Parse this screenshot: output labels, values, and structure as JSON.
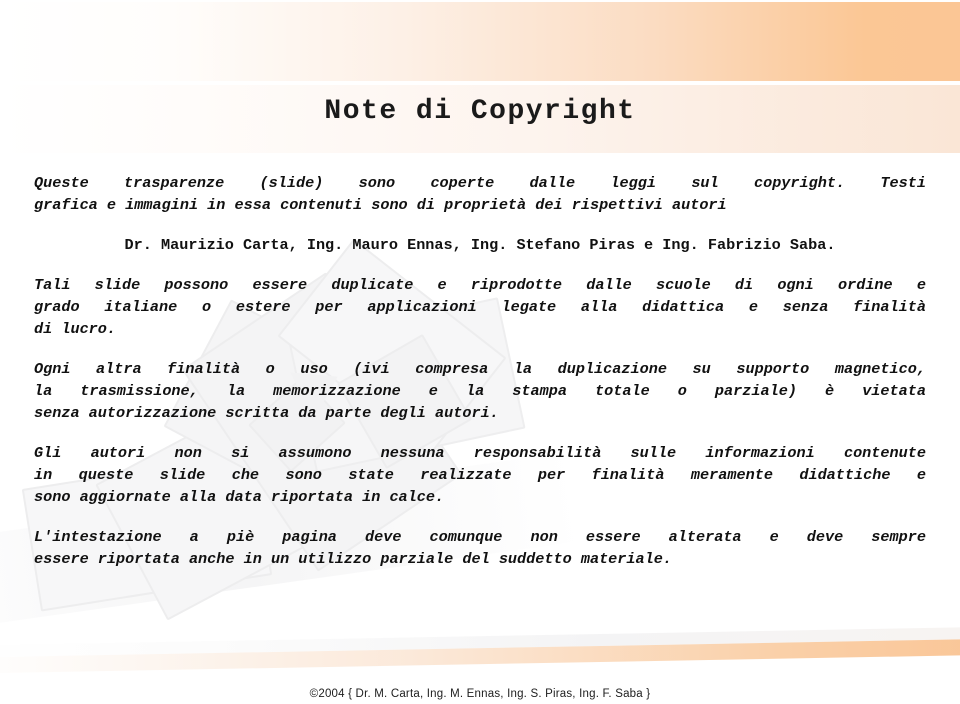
{
  "slide": {
    "title": "Note di Copyright",
    "accent_color": "#fbc695",
    "band_light_color": "#fae6d6",
    "text_color": "#111111"
  },
  "paragraphs": [
    {
      "id": "copyright-notice",
      "style": "bold-italic",
      "lines": [
        "Queste trasparenze (slide) sono coperte dalle leggi sul copyright. Testi",
        "grafica e immagini in essa contenuti sono di proprietà dei rispettivi autori"
      ]
    },
    {
      "id": "authors",
      "style": "bold",
      "lines": [
        "Dr. Maurizio Carta, Ing. Mauro Ennas, Ing. Stefano Piras e Ing. Fabrizio Saba."
      ]
    },
    {
      "id": "duplication-rights",
      "style": "bold-italic",
      "lines": [
        "Tali slide possono essere duplicate e riprodotte dalle scuole di ogni ordine e",
        "grado italiane o estere per applicazioni legate alla didattica e senza finalità",
        "di lucro."
      ]
    },
    {
      "id": "other-uses-forbidden",
      "style": "bold-italic",
      "lines": [
        "Ogni altra finalità o uso (ivi compresa la duplicazione su supporto magnetico,",
        "la trasmissione, la memorizzazione e la stampa totale o parziale) è vietata",
        "senza autorizzazione scritta da parte degli autori."
      ]
    },
    {
      "id": "liability-disclaimer",
      "style": "bold-italic",
      "lines": [
        "Gli autori non si assumono nessuna responsabilità sulle informazioni contenute",
        "in queste slide che sono state realizzate per finalità meramente didattiche e",
        "sono aggiornate alla data riportata in calce."
      ]
    },
    {
      "id": "footer-preservation",
      "style": "bold-italic",
      "lines": [
        "L'intestazione a piè pagina deve comunque non essere alterata e deve sempre",
        "essere riportata anche in un utilizzo parziale del suddetto materiale."
      ]
    }
  ],
  "footer": {
    "text": "©2004  { Dr. M. Carta, Ing. M. Ennas, Ing. S. Piras, Ing. F. Saba }"
  }
}
